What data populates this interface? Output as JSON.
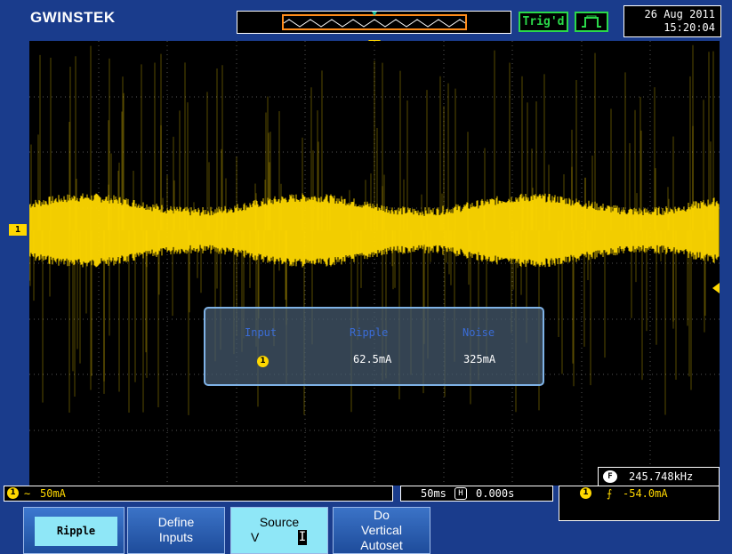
{
  "header": {
    "brand": "GWINSTEK",
    "trigger_status": "Trig'd",
    "date": "26 Aug 2011",
    "time": "15:20:04"
  },
  "screen": {
    "channel_marker": "1",
    "trace_color": "#ffd800"
  },
  "measurement": {
    "col_input": "Input",
    "col_ripple": "Ripple",
    "col_noise": "Noise",
    "input_value": "1",
    "ripple_value": "62.5mA",
    "noise_value": "325mA"
  },
  "frequency": {
    "icon": "F",
    "value": "245.748kHz"
  },
  "status_bar": {
    "channel_icon": "1",
    "coupling_symbol": "∼",
    "volts_div": "50mA",
    "time_div": "50ms",
    "h_icon": "H",
    "h_position": "0.000s",
    "trigger_channel": "1",
    "trigger_slope": "⨍",
    "trigger_level": "-54.0mA"
  },
  "softkeys": {
    "ripple": "Ripple",
    "define_line1": "Define",
    "define_line2": "Inputs",
    "source_line1": "Source",
    "source_v": "V",
    "source_i": "I",
    "do_line1": "Do",
    "do_line2": "Vertical",
    "do_line3": "Autoset"
  }
}
